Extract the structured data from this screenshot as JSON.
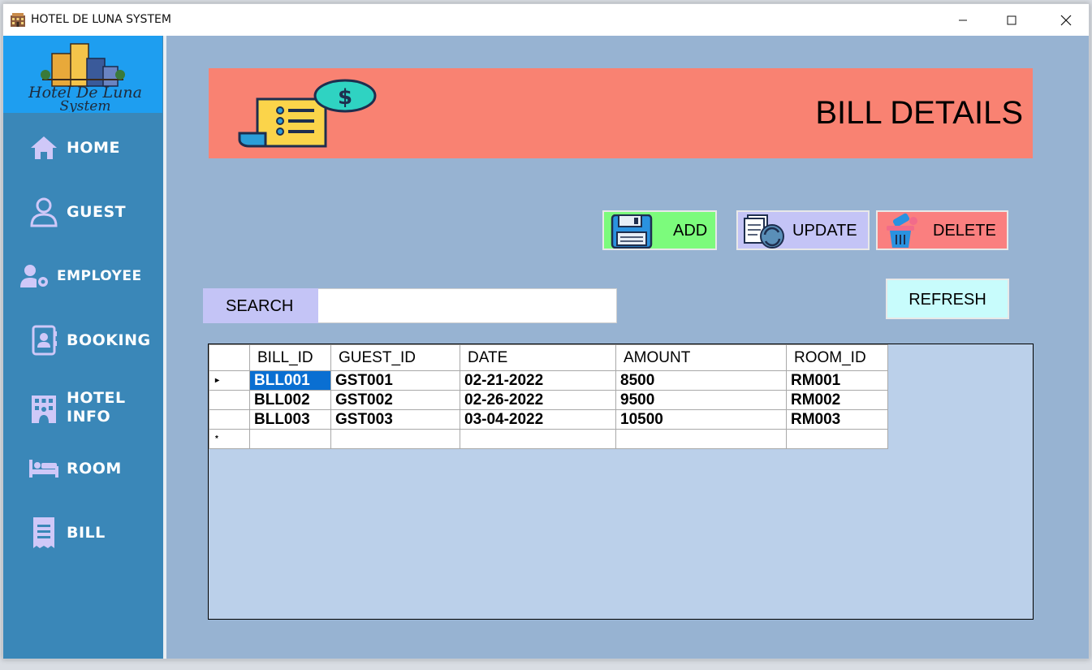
{
  "window": {
    "title": "HOTEL DE LUNA SYSTEM"
  },
  "logo": {
    "line1": "Hotel De Luna",
    "line2": "System"
  },
  "sidebar": {
    "items": [
      {
        "label": "HOME",
        "icon": "home-icon"
      },
      {
        "label": "GUEST",
        "icon": "user-icon"
      },
      {
        "label": "EMPLOYEE",
        "icon": "user-gear-icon"
      },
      {
        "label": "BOOKING",
        "icon": "contact-book-icon"
      },
      {
        "label": "HOTEL",
        "label2": "INFO",
        "icon": "hotel-icon"
      },
      {
        "label": "ROOM",
        "icon": "bed-icon"
      },
      {
        "label": "BILL",
        "icon": "receipt-icon"
      }
    ]
  },
  "banner": {
    "title": "BILL DETAILS",
    "icon": "bill-icon"
  },
  "actions": {
    "add": "ADD",
    "update": "UPDATE",
    "delete": "DELETE",
    "refresh": "REFRESH"
  },
  "search": {
    "label": "SEARCH",
    "value": ""
  },
  "table": {
    "columns": [
      "BILL_ID",
      "GUEST_ID",
      "DATE",
      "AMOUNT",
      "ROOM_ID"
    ],
    "rows": [
      [
        "BLL001",
        "GST001",
        "02-21-2022",
        "8500",
        "RM001"
      ],
      [
        "BLL002",
        "GST002",
        "02-26-2022",
        "9500",
        "RM002"
      ],
      [
        "BLL003",
        "GST003",
        "03-04-2022",
        "10500",
        "RM003"
      ]
    ],
    "selected_cell": "BLL001"
  },
  "colors": {
    "sidebar": "#3a87b8",
    "logo_bg": "#1e9ef0",
    "main_bg": "#97b3d2",
    "banner": "#f98272",
    "add": "#7cfb7c",
    "update": "#c4c4f6",
    "delete": "#fa7f7f",
    "refresh": "#c8fcfc",
    "grid_bg": "#bbd0ea",
    "selection": "#0a6fd2"
  }
}
